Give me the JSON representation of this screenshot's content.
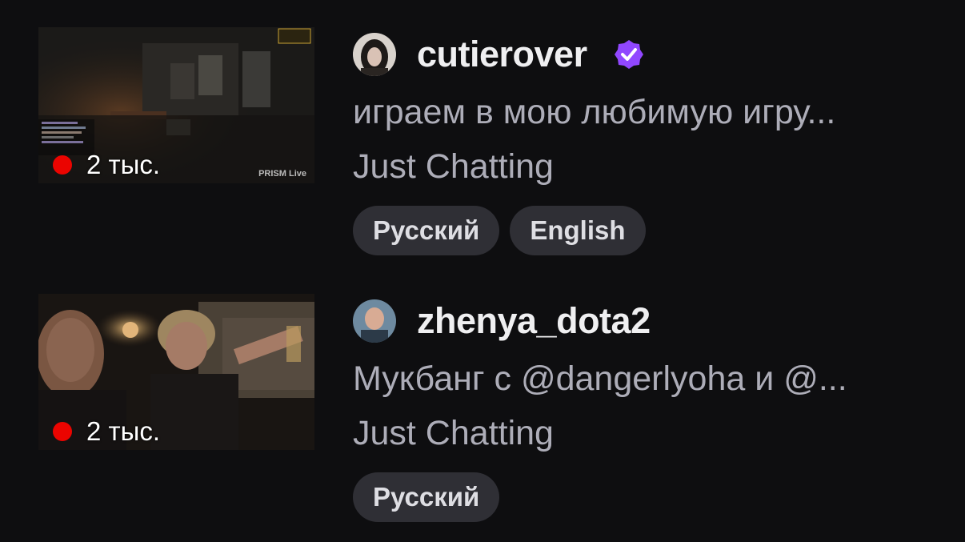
{
  "colors": {
    "background": "#0e0e10",
    "live": "#eb0400",
    "verified": "#9147ff",
    "tag_bg": "#2f2f35",
    "muted_text": "#adadb8"
  },
  "streams": [
    {
      "channel": "cutierover",
      "verified": true,
      "title": "играем в мою любимую игру...",
      "category": "Just Chatting",
      "viewers": "2 тыс.",
      "thumbnail_watermark": "PRISM Live",
      "tags": [
        "Русский",
        "English"
      ]
    },
    {
      "channel": "zhenya_dota2",
      "verified": false,
      "title": "Мукбанг с @dangerlyoha и @...",
      "category": "Just Chatting",
      "viewers": "2 тыс.",
      "tags": [
        "Русский"
      ]
    }
  ]
}
